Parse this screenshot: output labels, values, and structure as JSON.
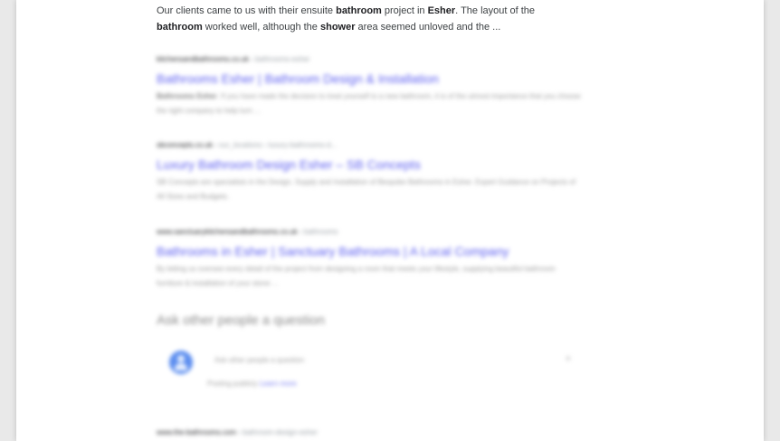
{
  "colors": {
    "link": "#5d5ff0",
    "text": "#3c4043",
    "avatar": "#5b8def"
  },
  "top_snippet": {
    "t1": "Our clients came to us with their ensuite ",
    "b1": "bathroom",
    "t2": " project in ",
    "b2": "Esher",
    "t3": ". The layout of the ",
    "b3": "bathroom",
    "t4": " worked well, although the ",
    "b4": "shower",
    "t5": " area seemed unloved and the ..."
  },
  "results": [
    {
      "site": "kitchensandbathrooms.co.uk",
      "crumb": "› bathrooms-esher",
      "title": "Bathrooms Esher | Bathroom Design & Installation",
      "desc_lead": "Bathrooms Esher",
      "desc": ". If you have made the decision to treat yourself to a new bathroom, it is of the utmost importance that you choose the right company to help turn ..."
    },
    {
      "site": "sbconcepts.co.uk",
      "crumb": "› our_locations › luxury-bathrooms-d...",
      "title": "Luxury Bathroom Design Esher – SB Concepts",
      "desc_lead": "",
      "desc": "SB Concepts are specialists in the Design, Supply and Installation of Bespoke Bathrooms in Esher. Expert Guidance on Projects of All Sizes and Budgets."
    },
    {
      "site": "www.sanctuarykitchensandbathrooms.co.uk",
      "crumb": "› bathrooms",
      "title": "Bathrooms in Esher | Sanctuary Bathrooms | A Local Company",
      "desc_lead": "",
      "desc": "By letting us oversee every detail of the project from designing a room that meets your lifestyle, supplying beautiful bathroom furniture & installation of your stone ..."
    }
  ],
  "paa": {
    "heading": "Ask other people a question",
    "prompt": "Ask other people a question",
    "close": "×",
    "foot": "Posting publicly",
    "learn": "Learn more"
  },
  "bottom_result": {
    "site": "www.the-bathrooms.com",
    "crumb": "› bathroom-design-esher"
  }
}
